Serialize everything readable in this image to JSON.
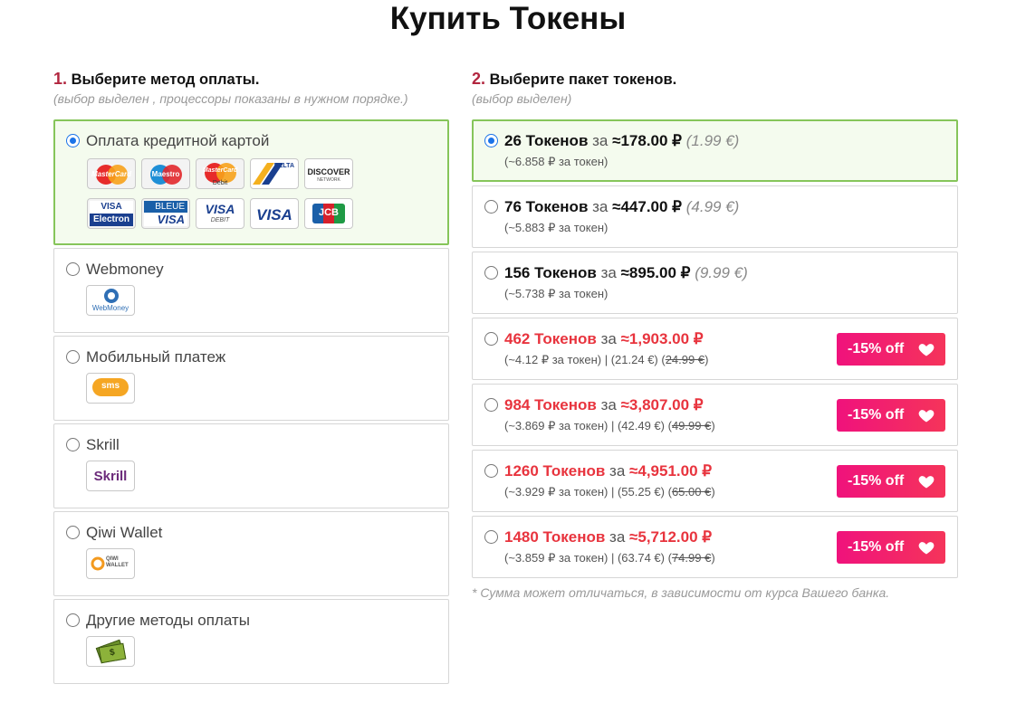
{
  "page": {
    "title": "Купить Токены"
  },
  "step1": {
    "num": "1.",
    "title": "Выберите метод оплаты.",
    "subtitle": "(выбор выделен , процессоры показаны в нужном порядке.)"
  },
  "step2": {
    "num": "2.",
    "title": "Выберите пакет токенов.",
    "subtitle": "(выбор выделен)"
  },
  "methods": [
    {
      "label": "Оплата кредитной картой",
      "selected": true
    },
    {
      "label": "Webmoney",
      "selected": false,
      "icon_text": "WebMoney"
    },
    {
      "label": "Мобильный платеж",
      "selected": false,
      "icon_text": "sms"
    },
    {
      "label": "Skrill",
      "selected": false,
      "icon_text": "Skrill"
    },
    {
      "label": "Qiwi Wallet",
      "selected": false,
      "icon_text": "QIWI WALLET"
    },
    {
      "label": "Другие методы оплаты",
      "selected": false,
      "icon_text": "$"
    }
  ],
  "cards": {
    "mastercard": "MasterCard",
    "maestro": "Maestro",
    "mastercard_debit": "MasterCard",
    "mastercard_debit_sub": "Debit",
    "delta": "DELTA",
    "discover": "DISCOVER",
    "discover_sub": "NETWORK",
    "visa_electron_top": "VISA",
    "visa_electron_bottom": "Electron",
    "carte_bleue_top": "BLEUE",
    "carte_bleue_bottom": "VISA",
    "visa_debit": "VISA",
    "visa_debit_sub": "DEBIT",
    "visa": "VISA",
    "jcb": "JCB"
  },
  "packages": [
    {
      "tokens": "26 Токенов",
      "za": "за",
      "price": "≈178.00 ₽",
      "eur": "(1.99 €)",
      "per": "(~6.858 ₽ за токен)",
      "selected": true,
      "sale": false
    },
    {
      "tokens": "76 Токенов",
      "za": "за",
      "price": "≈447.00 ₽",
      "eur": "(4.99 €)",
      "per": "(~5.883 ₽ за токен)",
      "selected": false,
      "sale": false
    },
    {
      "tokens": "156 Токенов",
      "za": "за",
      "price": "≈895.00 ₽",
      "eur": "(9.99 €)",
      "per": "(~5.738 ₽ за токен)",
      "selected": false,
      "sale": false
    },
    {
      "tokens": "462 Токенов",
      "za": "за",
      "price": "≈1,903.00 ₽",
      "per": "(~4.12 ₽ за токен) | (21.24 €) (",
      "old": "24.99 €",
      "close": ")",
      "badge": "-15% off",
      "selected": false,
      "sale": true
    },
    {
      "tokens": "984 Токенов",
      "za": "за",
      "price": "≈3,807.00 ₽",
      "per": "(~3.869 ₽ за токен) | (42.49 €) (",
      "old": "49.99 €",
      "close": ")",
      "badge": "-15% off",
      "selected": false,
      "sale": true
    },
    {
      "tokens": "1260 Токенов",
      "za": "за",
      "price": "≈4,951.00 ₽",
      "per": "(~3.929 ₽ за токен) | (55.25 €) (",
      "old": "65.00 €",
      "close": ")",
      "badge": "-15% off",
      "selected": false,
      "sale": true
    },
    {
      "tokens": "1480 Токенов",
      "za": "за",
      "price": "≈5,712.00 ₽",
      "per": "(~3.859 ₽ за токен) | (63.74 €) (",
      "old": "74.99 €",
      "close": ")",
      "badge": "-15% off",
      "selected": false,
      "sale": true
    }
  ],
  "footnote": "* Сумма может отличаться, в зависимости от курса Вашего банка.",
  "colors": {
    "selected_border": "#86c55a",
    "selected_bg": "#f4fbee",
    "sale_red": "#e8343e",
    "badge_pink": "#f0127c",
    "step_num": "#b2263f"
  }
}
